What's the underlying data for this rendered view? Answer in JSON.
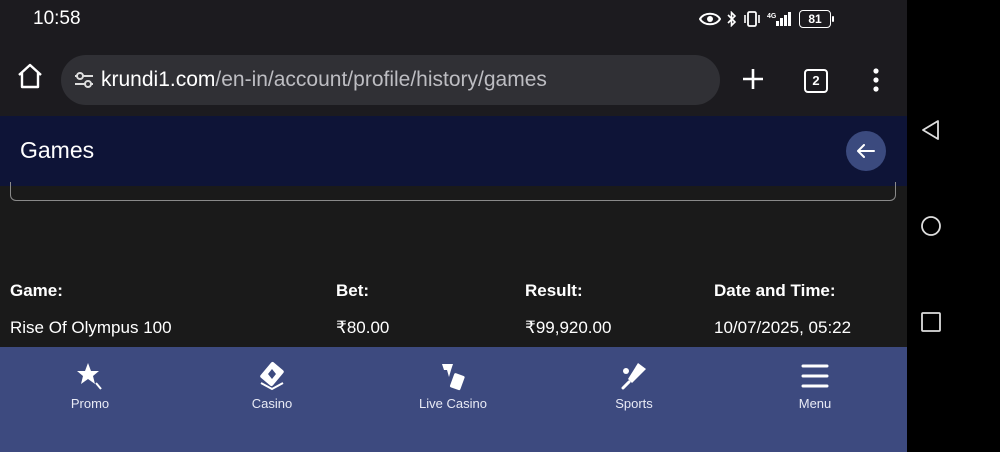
{
  "status_bar": {
    "time": "10:58",
    "battery": "81"
  },
  "browser": {
    "url_domain": "krundi1.com",
    "url_path": "/en-in/account/profile/history/games",
    "tab_count": "2"
  },
  "header": {
    "title": "Games"
  },
  "table": {
    "columns": [
      "Game:",
      "Bet:",
      "Result:",
      "Date and Time:"
    ],
    "rows": [
      [
        "Rise Of Olympus 100",
        "₹80.00",
        "₹99,920.00",
        "10/07/2025, 05:22"
      ]
    ]
  },
  "bottom_nav": {
    "items": [
      {
        "label": "Promo",
        "icon": "star-icon"
      },
      {
        "label": "Casino",
        "icon": "cards-icon"
      },
      {
        "label": "Live Casino",
        "icon": "dealer-icon"
      },
      {
        "label": "Sports",
        "icon": "sports-icon"
      },
      {
        "label": "Menu",
        "icon": "hamburger-icon"
      }
    ]
  },
  "colors": {
    "header_bg": "#0e1437",
    "nav_bg": "#3d4a7f",
    "back_button_bg": "#3b4a7e",
    "content_bg": "#1a1a1a"
  }
}
